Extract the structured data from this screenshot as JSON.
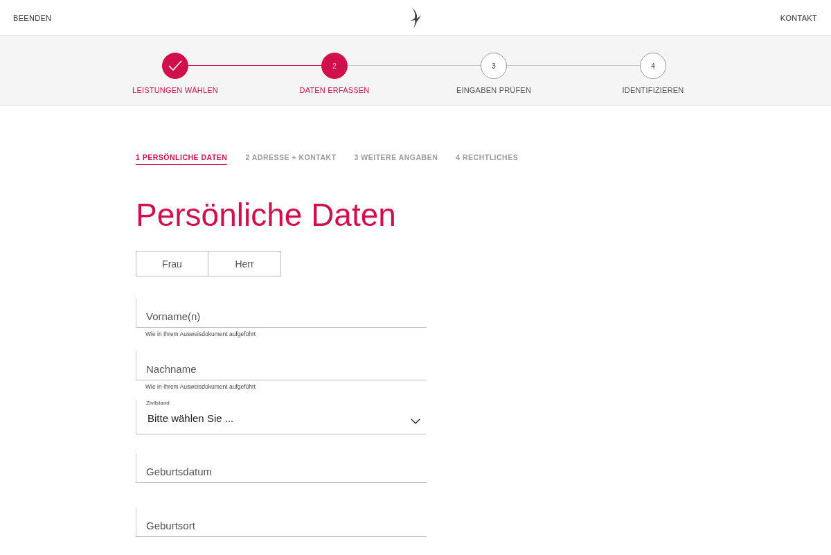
{
  "header": {
    "exit": "BEENDEN",
    "contact": "KONTAKT"
  },
  "steps": [
    {
      "kind": "done",
      "label": "LEISTUNGEN WÄHLEN"
    },
    {
      "kind": "current",
      "number": "2",
      "label": "DATEN ERFASSEN"
    },
    {
      "kind": "todo",
      "number": "3",
      "label": "EINGABEN PRÜFEN"
    },
    {
      "kind": "todo",
      "number": "4",
      "label": "IDENTIFIZIEREN"
    }
  ],
  "subtabs": [
    {
      "label": "1 PERSÖNLICHE DATEN",
      "selected": true
    },
    {
      "label": "2 ADRESSE + KONTAKT",
      "selected": false
    },
    {
      "label": "3 WEITERE ANGABEN",
      "selected": false
    },
    {
      "label": "4 RECHTLICHES",
      "selected": false
    }
  ],
  "title": "Persönliche Daten",
  "gender": [
    {
      "label": "Frau",
      "selected": false
    },
    {
      "label": "Herr",
      "selected": false
    }
  ],
  "fields": [
    {
      "kind": "text",
      "placeholder": "Vorname(n)",
      "hint": "Wie in Ihrem Ausweisdokument aufgeführt"
    },
    {
      "kind": "text",
      "placeholder": "Nachname",
      "hint": "Wie in Ihrem Ausweisdokument aufgeführt"
    },
    {
      "kind": "select",
      "label": "Zivilstand",
      "value": "Bitte wählen Sie ..."
    },
    {
      "kind": "text",
      "placeholder": "Geburtsdatum"
    },
    {
      "kind": "text",
      "placeholder": "Geburtsort"
    }
  ]
}
